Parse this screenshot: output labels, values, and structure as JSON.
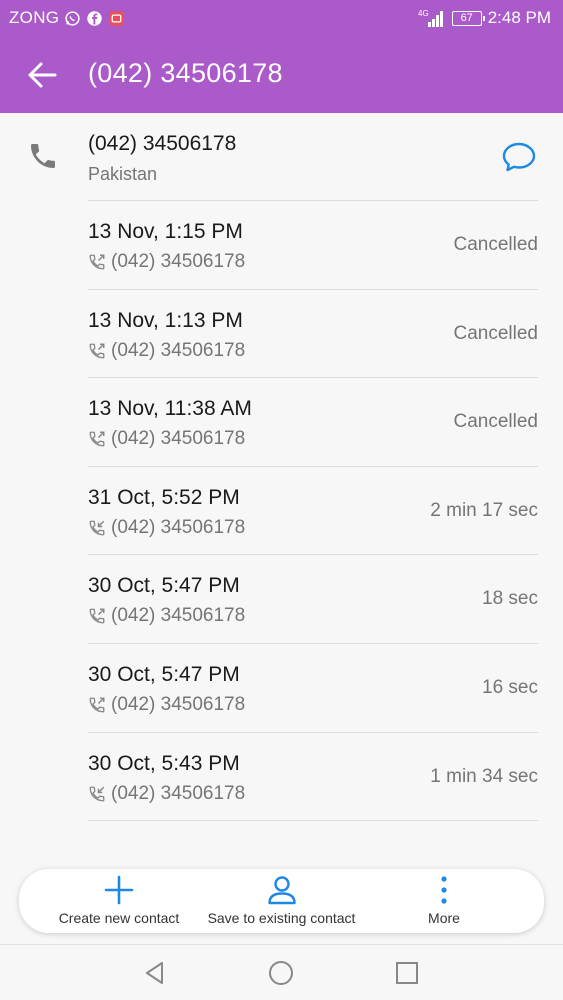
{
  "status_bar": {
    "carrier": "ZONG",
    "network": "4G",
    "battery": "67",
    "time": "2:48 PM",
    "icons": [
      "whatsapp-icon",
      "facebook-icon",
      "notification-icon",
      "signal-icon"
    ]
  },
  "app_bar": {
    "title": "(042) 34506178",
    "back_icon": "arrow-left-icon"
  },
  "contact": {
    "number": "(042) 34506178",
    "location": "Pakistan",
    "icon": "phone-icon",
    "message_icon": "message-bubble-icon"
  },
  "call_log": [
    {
      "time": "13 Nov, 1:15 PM",
      "number": "(042) 34506178",
      "status": "Cancelled",
      "direction": "outgoing"
    },
    {
      "time": "13 Nov, 1:13 PM",
      "number": "(042) 34506178",
      "status": "Cancelled",
      "direction": "outgoing"
    },
    {
      "time": "13 Nov, 11:38 AM",
      "number": "(042) 34506178",
      "status": "Cancelled",
      "direction": "outgoing"
    },
    {
      "time": "31 Oct, 5:52 PM",
      "number": "(042) 34506178",
      "status": "2 min 17 sec",
      "direction": "incoming"
    },
    {
      "time": "30 Oct, 5:47 PM",
      "number": "(042) 34506178",
      "status": "18 sec",
      "direction": "outgoing"
    },
    {
      "time": "30 Oct, 5:47 PM",
      "number": "(042) 34506178",
      "status": "16 sec",
      "direction": "outgoing"
    },
    {
      "time": "30 Oct, 5:43 PM",
      "number": "(042) 34506178",
      "status": "1 min 34 sec",
      "direction": "incoming"
    }
  ],
  "actions": {
    "create_new": "Create new contact",
    "save_existing": "Save to existing contact",
    "more": "More"
  },
  "colors": {
    "header": "#ab5ac9",
    "accent": "#1e88e5",
    "text_primary": "#1a1a1a",
    "text_secondary": "#757575"
  }
}
